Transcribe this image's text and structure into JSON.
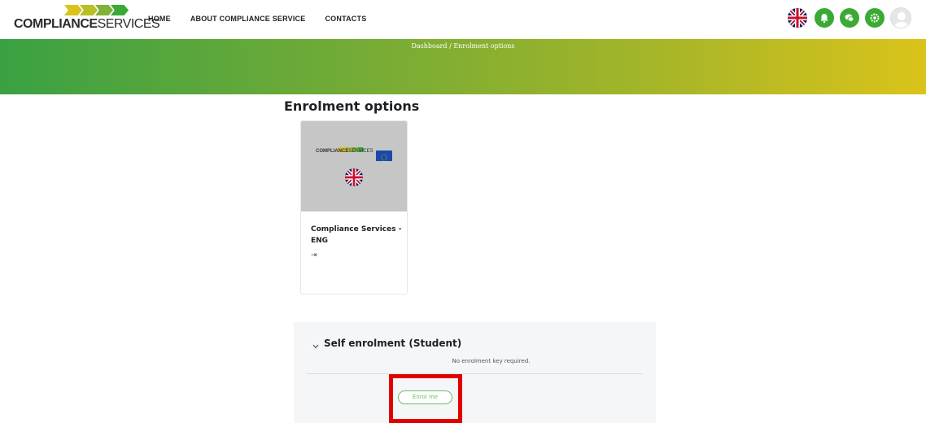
{
  "navbar": {
    "logo": {
      "bold": "COMPLIANCE",
      "light": "SERVICES"
    },
    "links": [
      "HOME",
      "ABOUT COMPLIANCE SERVICE",
      "CONTACTS"
    ],
    "icons": [
      "uk-flag-icon",
      "notification-icon",
      "messages-icon",
      "settings-icon",
      "user-avatar-icon"
    ]
  },
  "banner": {
    "breadcrumb": "Dashboard  /  Enrolment options"
  },
  "page": {
    "title": "Enrolment options"
  },
  "course": {
    "name": "Compliance Services - ENG",
    "image_logo": {
      "bold": "COMPLIANCE",
      "light": "SERVICES"
    },
    "enter_icon": "⇥"
  },
  "enrolment": {
    "heading": "Self enrolment (Student)",
    "note": "No enrolment key required.",
    "button": "Enrol me"
  },
  "colors": {
    "brand_green": "#3aaa35",
    "brand_yellow": "#dac31a",
    "highlight": "#e00000"
  }
}
